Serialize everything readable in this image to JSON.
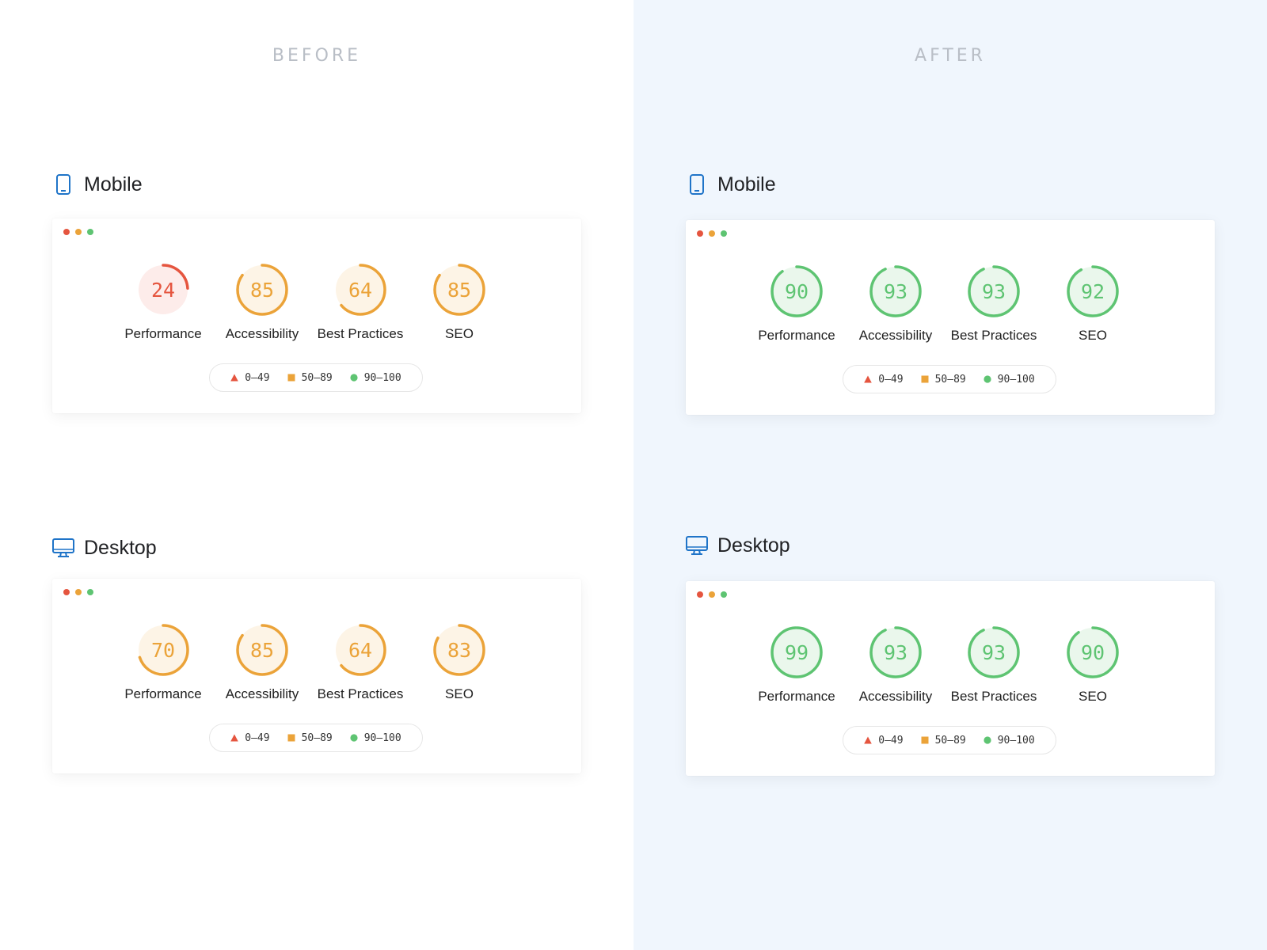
{
  "colors": {
    "fail": "#e5553f",
    "average": "#eba339",
    "pass": "#5ec472",
    "fail_bg": "#fdecea",
    "average_bg": "#fdf4e6",
    "pass_bg": "#eaf7ec",
    "device_icon": "#1f74c8",
    "before_bg": "#ffffff",
    "after_bg": "#f0f6fd"
  },
  "legend": [
    {
      "shape": "triangle",
      "label": "0–49",
      "color": "#e5553f"
    },
    {
      "shape": "square",
      "label": "50–89",
      "color": "#eba339"
    },
    {
      "shape": "circle",
      "label": "90–100",
      "color": "#5ec472"
    }
  ],
  "window_dots": [
    "#e5553f",
    "#eba339",
    "#5ec472"
  ],
  "before": {
    "title": "BEFORE",
    "mobile": {
      "label": "Mobile",
      "icon": "smartphone-icon",
      "scores": [
        {
          "name": "Performance",
          "value": 24
        },
        {
          "name": "Accessibility",
          "value": 85
        },
        {
          "name": "Best Practices",
          "value": 64
        },
        {
          "name": "SEO",
          "value": 85
        }
      ]
    },
    "desktop": {
      "label": "Desktop",
      "icon": "desktop-monitor-icon",
      "scores": [
        {
          "name": "Performance",
          "value": 70
        },
        {
          "name": "Accessibility",
          "value": 85
        },
        {
          "name": "Best Practices",
          "value": 64
        },
        {
          "name": "SEO",
          "value": 83
        }
      ]
    }
  },
  "after": {
    "title": "AFTER",
    "mobile": {
      "label": "Mobile",
      "icon": "smartphone-icon",
      "scores": [
        {
          "name": "Performance",
          "value": 90
        },
        {
          "name": "Accessibility",
          "value": 93
        },
        {
          "name": "Best Practices",
          "value": 93
        },
        {
          "name": "SEO",
          "value": 92
        }
      ]
    },
    "desktop": {
      "label": "Desktop",
      "icon": "desktop-monitor-icon",
      "scores": [
        {
          "name": "Performance",
          "value": 99
        },
        {
          "name": "Accessibility",
          "value": 93
        },
        {
          "name": "Best Practices",
          "value": 93
        },
        {
          "name": "SEO",
          "value": 90
        }
      ]
    }
  }
}
